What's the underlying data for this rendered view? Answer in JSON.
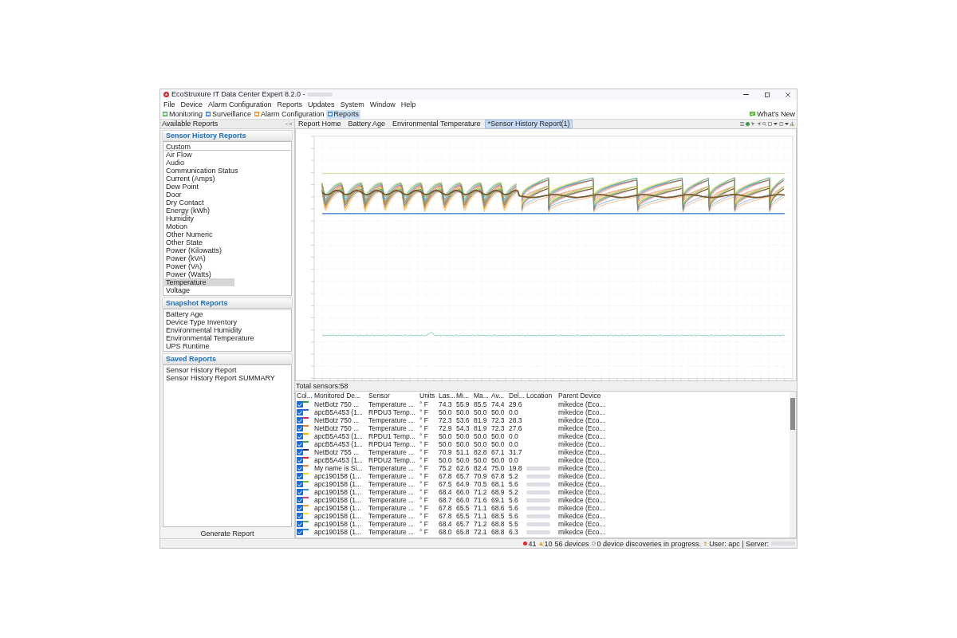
{
  "window": {
    "title": "EcoStruxure IT Data Center Expert 8.2.0 -",
    "title_redacted": true
  },
  "menu": [
    "File",
    "Device",
    "Alarm Configuration",
    "Reports",
    "Updates",
    "System",
    "Window",
    "Help"
  ],
  "perspectives": [
    {
      "label": "Monitoring",
      "color": "#4caf50",
      "selected": false
    },
    {
      "label": "Surveillance",
      "color": "#3d7fd6",
      "selected": false
    },
    {
      "label": "Alarm Configuration",
      "color": "#f08c2a",
      "selected": false
    },
    {
      "label": "Reports",
      "color": "#3d7fd6",
      "selected": true
    }
  ],
  "whats_new": {
    "label": "What's New"
  },
  "left_panel": {
    "title": "Available Reports",
    "sections": [
      {
        "title": "Sensor History Reports",
        "items": [
          {
            "label": "Custom",
            "selected": false
          },
          {
            "label": "Air Flow",
            "selected": false
          },
          {
            "label": "Audio",
            "selected": false
          },
          {
            "label": "Communication Status",
            "selected": false
          },
          {
            "label": "Current (Amps)",
            "selected": false
          },
          {
            "label": "Dew Point",
            "selected": false
          },
          {
            "label": "Door",
            "selected": false
          },
          {
            "label": "Dry Contact",
            "selected": false
          },
          {
            "label": "Energy (kWh)",
            "selected": false
          },
          {
            "label": "Humidity",
            "selected": false
          },
          {
            "label": "Motion",
            "selected": false
          },
          {
            "label": "Other Numeric",
            "selected": false
          },
          {
            "label": "Other State",
            "selected": false
          },
          {
            "label": "Power (Kilowatts)",
            "selected": false
          },
          {
            "label": "Power (kVA)",
            "selected": false
          },
          {
            "label": "Power (VA)",
            "selected": false
          },
          {
            "label": "Power (Watts)",
            "selected": false
          },
          {
            "label": "Temperature",
            "selected": true
          },
          {
            "label": "Voltage",
            "selected": false
          }
        ]
      },
      {
        "title": "Snapshot Reports",
        "items": [
          {
            "label": "Battery Age",
            "selected": false
          },
          {
            "label": "Device Type Inventory",
            "selected": false
          },
          {
            "label": "Environmental Humidity",
            "selected": false
          },
          {
            "label": "Environmental Temperature",
            "selected": false
          },
          {
            "label": "UPS Runtime",
            "selected": false
          }
        ]
      },
      {
        "title": "Saved Reports",
        "items": [
          {
            "label": "Sensor History Report",
            "selected": false
          },
          {
            "label": "Sensor History Report SUMMARY",
            "selected": false
          }
        ]
      }
    ],
    "button": "Generate Report"
  },
  "report_tabs": [
    {
      "label": "Report Home",
      "selected": false
    },
    {
      "label": "Battery Age",
      "selected": false
    },
    {
      "label": "Environmental Temperature",
      "selected": false
    },
    {
      "label": "*Sensor History Report(1)",
      "selected": true
    }
  ],
  "total_sensors": "Total sensors:58",
  "table": {
    "columns": [
      "Col...",
      "Monitored De...",
      "Sensor",
      "Units",
      "Las...",
      "Mi...",
      "Ma...",
      "Av...",
      "Del...",
      "Location",
      "Parent Device"
    ],
    "rows": [
      {
        "checked": true,
        "color": "#2e9e3e",
        "device": "NetBotz 750 ...",
        "sensor": "Temperature ...",
        "units": "° F",
        "last": "74.3",
        "min": "55.9",
        "max": "85.5",
        "avg": "74.4",
        "delta": "29.6",
        "location_redacted": false,
        "parent_device": "mikedce (Eco..."
      },
      {
        "checked": true,
        "color": "#1f6fd1",
        "device": "apcB5A453 (1...",
        "sensor": "RPDU3 Temp...",
        "units": "° F",
        "last": "50.0",
        "min": "50.0",
        "max": "50.0",
        "avg": "50.0",
        "delta": "0.0",
        "location_redacted": false,
        "parent_device": "mikedce (Eco..."
      },
      {
        "checked": true,
        "color": "#d6275c",
        "device": "NetBotz 750 ...",
        "sensor": "Temperature ...",
        "units": "° F",
        "last": "72.3",
        "min": "53.6",
        "max": "81.9",
        "avg": "72.3",
        "delta": "28.3",
        "location_redacted": false,
        "parent_device": "mikedce (Eco..."
      },
      {
        "checked": true,
        "color": "#e8792a",
        "device": "NetBotz 750 ...",
        "sensor": "Temperature ...",
        "units": "° F",
        "last": "72.9",
        "min": "54.3",
        "max": "81.9",
        "avg": "72.3",
        "delta": "27.6",
        "location_redacted": false,
        "parent_device": "mikedce (Eco..."
      },
      {
        "checked": true,
        "color": "#f0b400",
        "device": "apcB5A453 (1...",
        "sensor": "RPDU1 Temp...",
        "units": "° F",
        "last": "50.0",
        "min": "50.0",
        "max": "50.0",
        "avg": "50.0",
        "delta": "0.0",
        "location_redacted": false,
        "parent_device": "mikedce (Eco..."
      },
      {
        "checked": true,
        "color": "#3aa845",
        "device": "apcB5A453 (1...",
        "sensor": "RPDU4 Temp...",
        "units": "° F",
        "last": "50.0",
        "min": "50.0",
        "max": "50.0",
        "avg": "50.0",
        "delta": "0.0",
        "location_redacted": false,
        "parent_device": "mikedce (Eco..."
      },
      {
        "checked": true,
        "color": "#1b2a6b",
        "device": "NetBotz 755 ...",
        "sensor": "Temperature ...",
        "units": "° F",
        "last": "70.9",
        "min": "51.1",
        "max": "82.8",
        "avg": "67.1",
        "delta": "31.7",
        "location_redacted": false,
        "parent_device": "mikedce (Eco..."
      },
      {
        "checked": true,
        "color": "#d42020",
        "device": "apcB5A453 (1...",
        "sensor": "RPDU2 Temp...",
        "units": "° F",
        "last": "50.0",
        "min": "50.0",
        "max": "50.0",
        "avg": "50.0",
        "delta": "0.0",
        "location_redacted": false,
        "parent_device": "mikedce (Eco..."
      },
      {
        "checked": true,
        "color": "#f08a24",
        "device": "My name is Si...",
        "sensor": "Temperature ...",
        "units": "° F",
        "last": "75.2",
        "min": "62.6",
        "max": "82.4",
        "avg": "75.0",
        "delta": "19.8",
        "location_redacted": true,
        "parent_device": "mikedce (Eco..."
      },
      {
        "checked": true,
        "color": "#f2d027",
        "device": "apc190158 (1...",
        "sensor": "Temperature ...",
        "units": "° F",
        "last": "67.8",
        "min": "65.7",
        "max": "70.9",
        "avg": "67.8",
        "delta": "5.2",
        "location_redacted": true,
        "parent_device": "mikedce (Eco..."
      },
      {
        "checked": true,
        "color": "#6bbf3a",
        "device": "apc190158 (1...",
        "sensor": "Temperature ...",
        "units": "° F",
        "last": "67.5",
        "min": "64.9",
        "max": "70.5",
        "avg": "68.1",
        "delta": "5.6",
        "location_redacted": true,
        "parent_device": "mikedce (Eco..."
      },
      {
        "checked": true,
        "color": "#2d8fd8",
        "device": "apc190158 (1...",
        "sensor": "Temperature ...",
        "units": "° F",
        "last": "68.4",
        "min": "66.0",
        "max": "71.2",
        "avg": "68.9",
        "delta": "5.2",
        "location_redacted": true,
        "parent_device": "mikedce (Eco..."
      },
      {
        "checked": true,
        "color": "#e0435a",
        "device": "apc190158 (1...",
        "sensor": "Temperature ...",
        "units": "° F",
        "last": "68.7",
        "min": "66.0",
        "max": "71.6",
        "avg": "69.1",
        "delta": "5.6",
        "location_redacted": true,
        "parent_device": "mikedce (Eco..."
      },
      {
        "checked": true,
        "color": "#f39c34",
        "device": "apc190158 (1...",
        "sensor": "Temperature ...",
        "units": "° F",
        "last": "67.8",
        "min": "65.5",
        "max": "71.1",
        "avg": "68.6",
        "delta": "5.6",
        "location_redacted": true,
        "parent_device": "mikedce (Eco..."
      },
      {
        "checked": true,
        "color": "#f5e042",
        "device": "apc190158 (1...",
        "sensor": "Temperature ...",
        "units": "° F",
        "last": "67.8",
        "min": "65.5",
        "max": "71.1",
        "avg": "68.5",
        "delta": "5.6",
        "location_redacted": true,
        "parent_device": "mikedce (Eco..."
      },
      {
        "checked": true,
        "color": "#4caf50",
        "device": "apc190158 (1...",
        "sensor": "Temperature ...",
        "units": "° F",
        "last": "68.4",
        "min": "65.7",
        "max": "71.2",
        "avg": "68.8",
        "delta": "5.5",
        "location_redacted": true,
        "parent_device": "mikedce (Eco..."
      },
      {
        "checked": true,
        "color": "#2f86d4",
        "device": "apc190158 (1...",
        "sensor": "Temperature ...",
        "units": "° F",
        "last": "68.0",
        "min": "65.8",
        "max": "72.1",
        "avg": "68.8",
        "delta": "6.3",
        "location_redacted": true,
        "parent_device": "mikedce (Eco..."
      }
    ]
  },
  "status_bar": {
    "critical_count": "41",
    "warning_count": "10",
    "devices": "56 devices",
    "discoveries": "0 device discoveries in progress.",
    "user": "User: apc | Server:",
    "server_redacted": true
  }
}
